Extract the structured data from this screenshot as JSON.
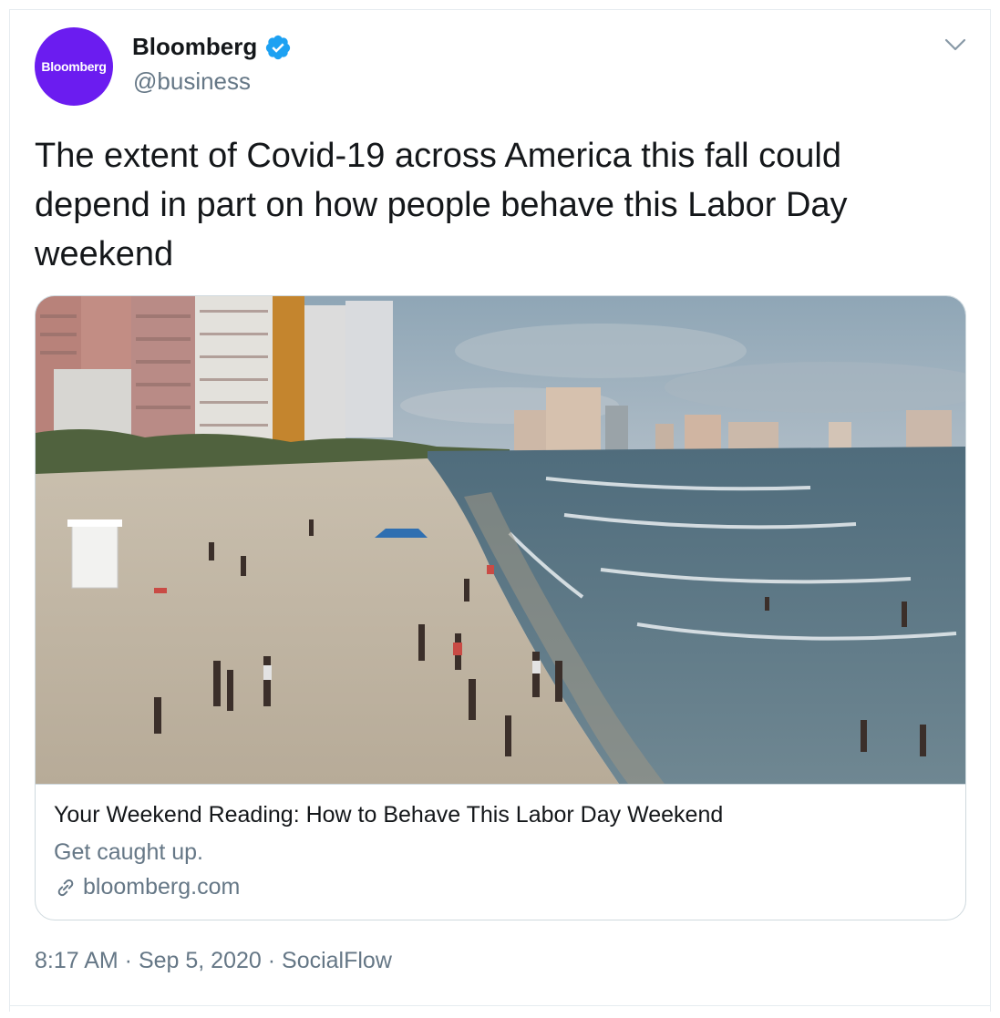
{
  "tweet": {
    "avatar_text": "Bloomberg",
    "author_name": "Bloomberg",
    "author_handle": "@business",
    "verified": true,
    "text": "The extent of Covid-19 across America this fall could depend in part on how people behave this Labor Day weekend",
    "card": {
      "title": "Your Weekend Reading: How to Behave This Labor Day Weekend",
      "description": "Get caught up.",
      "domain": "bloomberg.com",
      "image_subject": "crowded beach with high-rise hotels and ocean surf"
    },
    "time": "8:17 AM",
    "separator": " · ",
    "date": "Sep 5, 2020",
    "source": "SocialFlow"
  },
  "icons": {
    "verified": "verified-badge-icon",
    "more": "chevron-down-icon",
    "link": "link-icon"
  },
  "colors": {
    "avatar_bg": "#6b1cf0",
    "verified_blue": "#1da1f2",
    "text": "#14171a",
    "muted": "#657786",
    "border": "#cfd9de"
  }
}
